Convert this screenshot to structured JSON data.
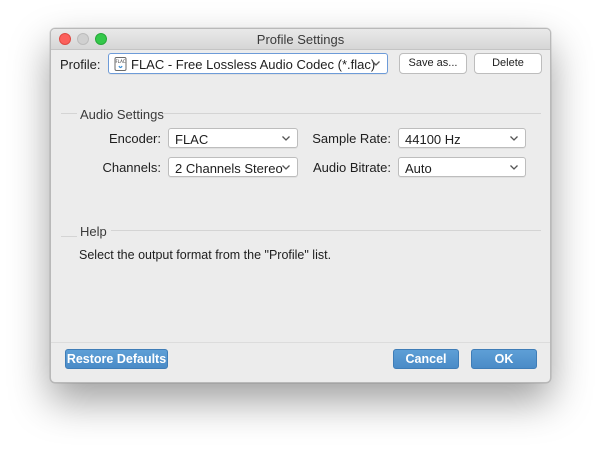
{
  "window": {
    "title": "Profile Settings"
  },
  "profile": {
    "label": "Profile:",
    "value": "FLAC - Free Lossless Audio Codec (*.flac)",
    "icon": "flac-file-icon",
    "save_label": "Save as...",
    "delete_label": "Delete"
  },
  "audio": {
    "heading": "Audio Settings",
    "encoder_label": "Encoder:",
    "encoder_value": "FLAC",
    "channels_label": "Channels:",
    "channels_value": "2 Channels Stereo",
    "sample_rate_label": "Sample Rate:",
    "sample_rate_value": "44100 Hz",
    "bitrate_label": "Audio Bitrate:",
    "bitrate_value": "Auto"
  },
  "help": {
    "heading": "Help",
    "text": "Select the output format from the \"Profile\" list."
  },
  "footer": {
    "restore_label": "Restore Defaults",
    "cancel_label": "Cancel",
    "ok_label": "OK"
  },
  "colors": {
    "accent_button": "#4a8bc7",
    "close_light": "#fc605c",
    "zoom_light": "#34c84a"
  }
}
